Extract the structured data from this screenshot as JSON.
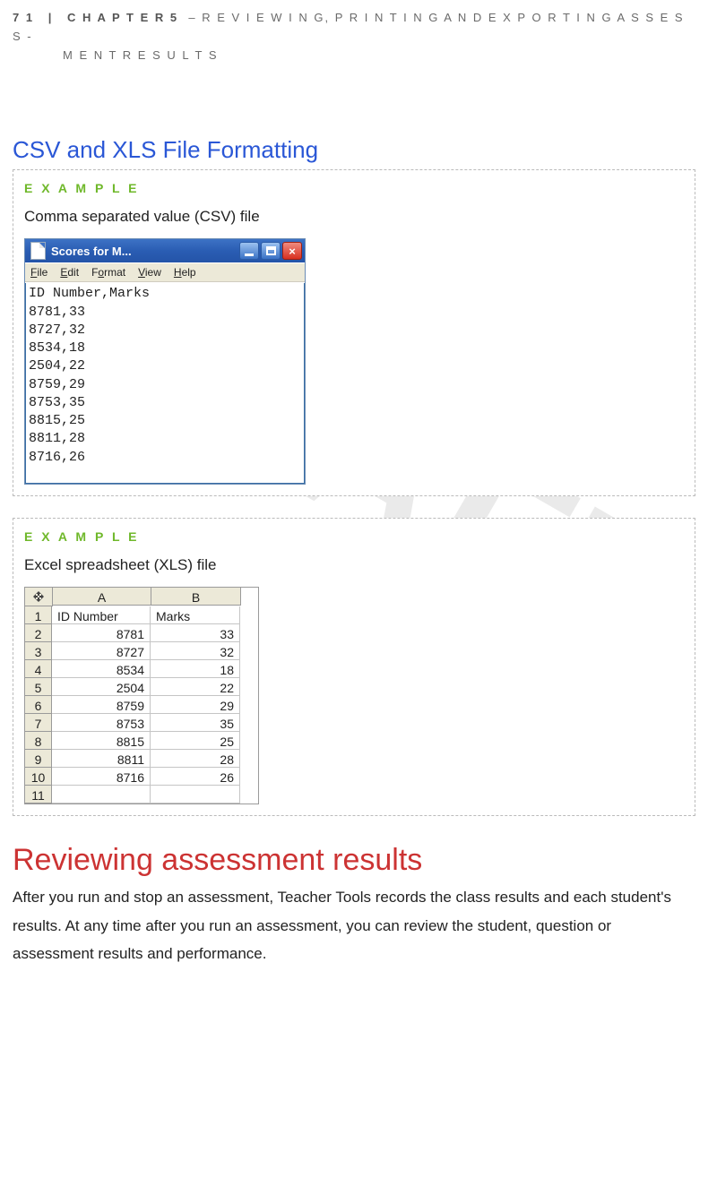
{
  "header": {
    "page_num": "7 1",
    "chapter": "C H A P T E R  5",
    "title_line1": "– R E V I E W I N G,  P R I N T I N G  A N D  E X P O R T I N G  A S S E S S -",
    "title_line2": "M E N T  R E S U L T S"
  },
  "section_heading": "CSV and XLS File Formatting",
  "example_label": "E X A M P L E",
  "csv": {
    "desc": "Comma separated value (CSV) file",
    "window_title": "Scores for M...",
    "menus": [
      "File",
      "Edit",
      "Format",
      "View",
      "Help"
    ],
    "header_line": "ID Number,Marks",
    "rows": [
      "8781,33",
      "8727,32",
      "8534,18",
      "2504,22",
      "8759,29",
      "8753,35",
      "8815,25",
      "8811,28",
      "8716,26"
    ]
  },
  "xls": {
    "desc": "Excel spreadsheet (XLS) file",
    "col_headers": [
      "A",
      "B"
    ],
    "row1": [
      "ID Number",
      "Marks"
    ],
    "data": [
      {
        "id": "8781",
        "marks": "33"
      },
      {
        "id": "8727",
        "marks": "32"
      },
      {
        "id": "8534",
        "marks": "18"
      },
      {
        "id": "2504",
        "marks": "22"
      },
      {
        "id": "8759",
        "marks": "29"
      },
      {
        "id": "8753",
        "marks": "35"
      },
      {
        "id": "8815",
        "marks": "25"
      },
      {
        "id": "8811",
        "marks": "28"
      },
      {
        "id": "8716",
        "marks": "26"
      }
    ],
    "row_numbers": [
      "1",
      "2",
      "3",
      "4",
      "5",
      "6",
      "7",
      "8",
      "9",
      "10",
      "11"
    ]
  },
  "review": {
    "heading": "Reviewing assessment results",
    "body": "After you run and stop an assessment, Teacher Tools records the class results and each student's results. At any time after you run an assessment, you can review the student, question or assessment results and performance."
  },
  "watermark": "RAFT"
}
